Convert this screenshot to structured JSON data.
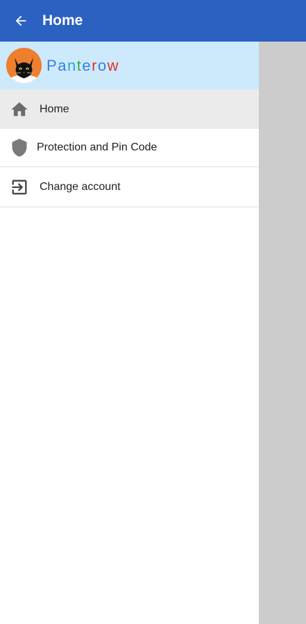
{
  "appbar": {
    "title": "Home",
    "back_icon": "arrow-left-icon",
    "background": "#2b62c2"
  },
  "drawer": {
    "header": {
      "brand_letters": [
        "P",
        "a",
        "n",
        "t",
        "e",
        "r",
        "o",
        "w"
      ],
      "brand_colors": [
        "#3a7be0",
        "#3a7be0",
        "#2f9fd8",
        "#37a84a",
        "#3a7be0",
        "#e2312a",
        "#3a7be0",
        "#e2312a"
      ],
      "avatar_icon": "black-cat-icon",
      "background": "#cdeafd"
    },
    "items": [
      {
        "label": "Home",
        "icon": "home-icon",
        "active": true
      },
      {
        "label": "Protection and Pin Code",
        "icon": "shield-icon",
        "active": false
      },
      {
        "label": "Change account",
        "icon": "exit-icon",
        "active": false
      }
    ]
  }
}
